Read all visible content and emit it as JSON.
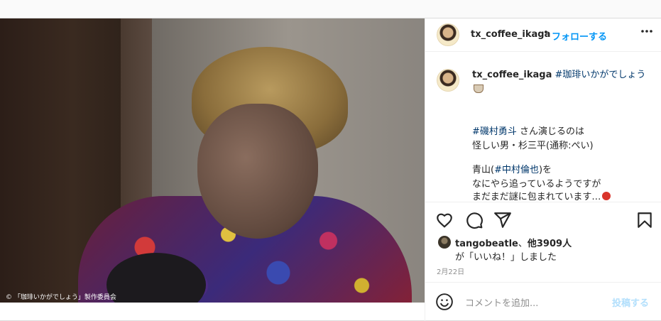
{
  "photo": {
    "copyright_text": "© 「珈琲いかがでしょう」製作委員会"
  },
  "header": {
    "username": "tx_coffee_ikaga",
    "separator": "•",
    "follow_label": "フォローする",
    "more_label": "•••"
  },
  "caption": {
    "username": "tx_coffee_ikaga",
    "hashtag_title": "#珈琲いかがでしょう",
    "line1_tag": "#磯村勇斗",
    "line1_text": " さん演じるのは",
    "line2": "怪しい男・杉三平(通称:ぺい)",
    "line3_prefix": "青山(",
    "line3_tag": "#中村倫也",
    "line3_suffix": ")を",
    "line4": "なにやら追っているようですが",
    "line5": "まだまだ謎に包まれています…"
  },
  "likes": {
    "liker": "tangobeatle",
    "sep": "、",
    "others": "他3909人",
    "suffix": "が「いいね！」しました"
  },
  "date": "2月22日",
  "comment": {
    "placeholder": "コメントを追加...",
    "post_label": "投稿する"
  },
  "colors": {
    "accent_blue": "#0095f6",
    "tag_blue": "#00376b",
    "post_disabled": "#b2dffc"
  },
  "icons": [
    "heart-icon",
    "comment-icon",
    "share-icon",
    "bookmark-icon",
    "emoji-icon",
    "more-icon",
    "coffee-icon",
    "flower-icon"
  ]
}
